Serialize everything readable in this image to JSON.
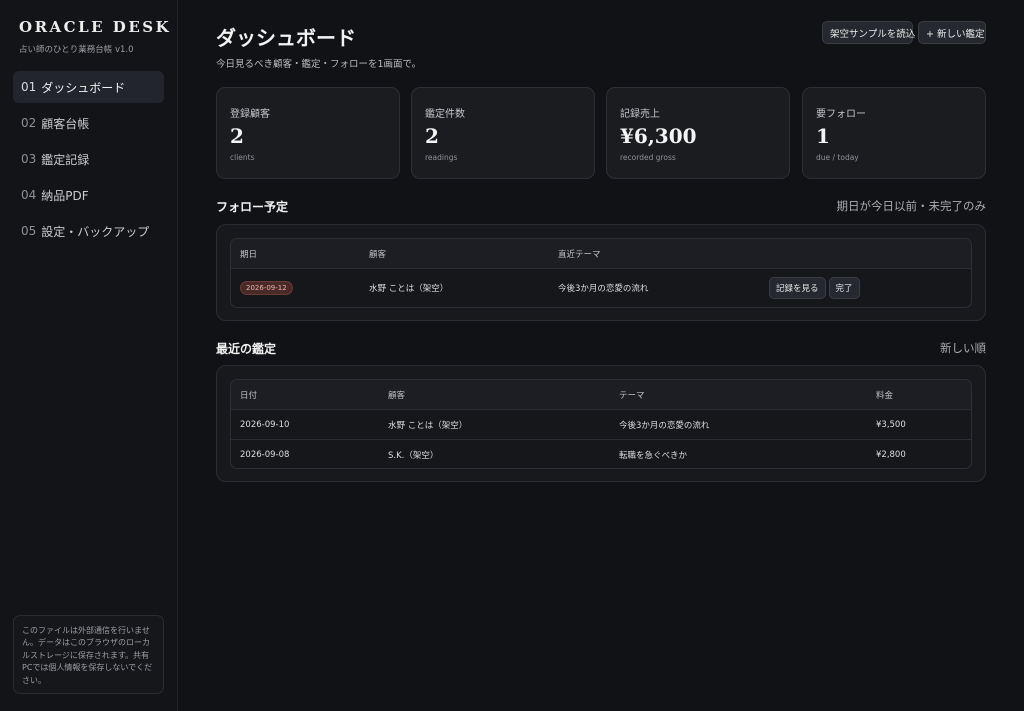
{
  "sidebar": {
    "brand": "ORACLE DESK",
    "subtitle": "占い師のひとり業務台帳 v1.0",
    "items": [
      {
        "num": "01",
        "label": "ダッシュボード"
      },
      {
        "num": "02",
        "label": "顧客台帳"
      },
      {
        "num": "03",
        "label": "鑑定記録"
      },
      {
        "num": "04",
        "label": "納品PDF"
      },
      {
        "num": "05",
        "label": "設定・バックアップ"
      }
    ],
    "notice": "このファイルは外部通信を行いません。データはこのブラウザのローカルストレージに保存されます。共有PCでは個人情報を保存しないでください。"
  },
  "header": {
    "title": "ダッシュボード",
    "subtitle": "今日見るべき顧客・鑑定・フォローを1画面で。",
    "sample_button": "架空サンプルを読込",
    "new_button": "+ 新しい鑑定"
  },
  "stats": [
    {
      "label": "登録顧客",
      "value": "2",
      "unit": "clients"
    },
    {
      "label": "鑑定件数",
      "value": "2",
      "unit": "readings"
    },
    {
      "label": "記録売上",
      "value": "¥6,300",
      "unit": "recorded gross"
    },
    {
      "label": "要フォロー",
      "value": "1",
      "unit": "due / today"
    }
  ],
  "follow": {
    "title": "フォロー予定",
    "note": "期日が今日以前・未完了のみ",
    "headers": [
      "期日",
      "顧客",
      "直近テーマ"
    ],
    "rows": [
      {
        "date": "2026-09-12",
        "client": "水野 ことは（架空）",
        "theme": "今後3か月の恋愛の流れ",
        "view_button": "記録を見る",
        "done_button": "完了"
      }
    ]
  },
  "recent": {
    "title": "最近の鑑定",
    "note": "新しい順",
    "headers": [
      "日付",
      "顧客",
      "テーマ",
      "料金"
    ],
    "rows": [
      {
        "date": "2026-09-10",
        "client": "水野 ことは（架空）",
        "theme": "今後3か月の恋愛の流れ",
        "fee": "¥3,500"
      },
      {
        "date": "2026-09-08",
        "client": "S.K.（架空）",
        "theme": "転職を急ぐべきか",
        "fee": "¥2,800"
      }
    ]
  },
  "colors": {
    "background": "#111215",
    "panel": "#17191d",
    "badge": "#4a2a28"
  }
}
